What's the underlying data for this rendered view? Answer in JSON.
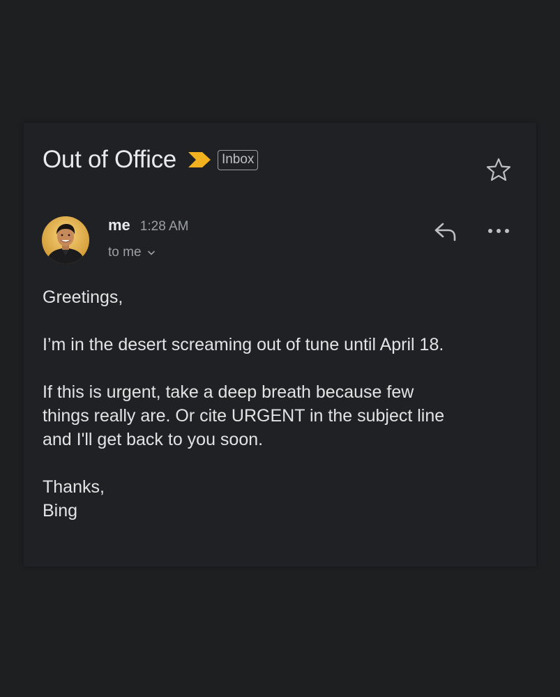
{
  "email": {
    "subject": "Out of Office",
    "label": "Inbox",
    "sender": "me",
    "time": "1:28 AM",
    "recipient": "to me",
    "body": {
      "greeting": "Greetings,",
      "paragraph1": "I’m in the desert screaming out of tune until April 18.",
      "paragraph2_line1": "If this is urgent, take a deep breath because few",
      "paragraph2_line2": "things really are. Or cite URGENT in the subject line",
      "paragraph2_line3": "and I'll get back to you soon.",
      "signoff": "Thanks,",
      "signature": "Bing"
    }
  },
  "icons": {
    "importance": "importance-marker-icon",
    "star": "star-icon",
    "reply": "reply-icon",
    "more": "more-horizontal-icon",
    "expand": "chevron-down-icon"
  },
  "colors": {
    "background": "#1e1f21",
    "card": "#202124",
    "importance_marker": "#f2b11f",
    "text_primary": "#e8eaed",
    "text_secondary": "#9aa0a6"
  }
}
